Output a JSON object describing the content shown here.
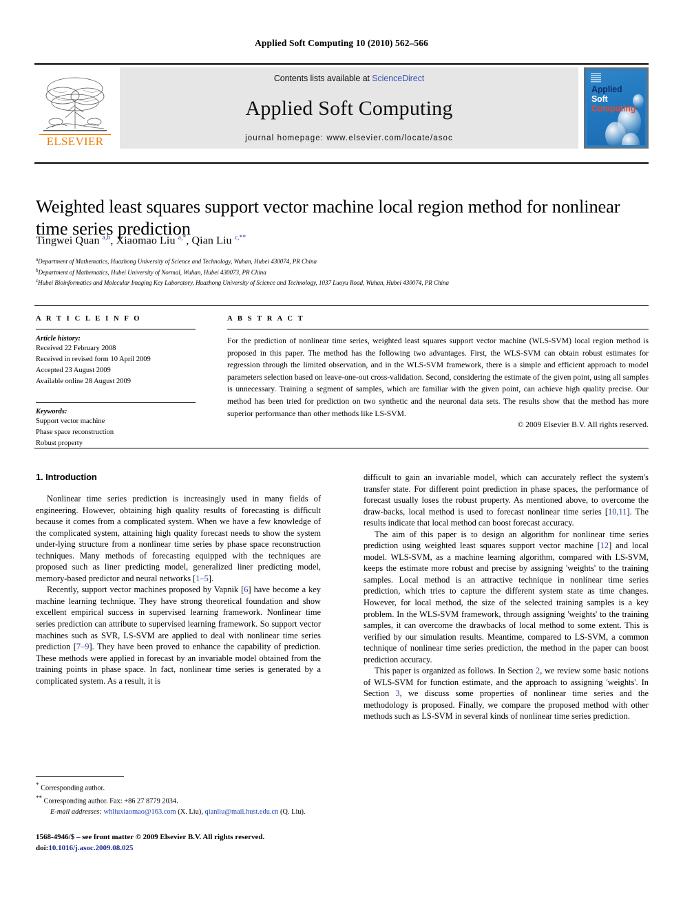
{
  "running_head": "Applied Soft Computing 10 (2010) 562–566",
  "header": {
    "contents_prefix": "Contents lists available at ",
    "sciencedirect": "ScienceDirect",
    "journal_title": "Applied Soft Computing",
    "homepage": "journal homepage: www.elsevier.com/locate/asoc",
    "publisher": "ELSEVIER",
    "cover": {
      "word1": "Applied",
      "word2": "Soft",
      "word3": "Computing",
      "bg_color": "#2076bd",
      "word1_color": "#10306e",
      "word2_color": "#ffffff",
      "word3_color": "#e8492c"
    },
    "link_color": "#3a52b5",
    "elsevier_color": "#f07c00"
  },
  "article": {
    "title": "Weighted least squares support vector machine local region method for nonlinear time series prediction",
    "authors_html": "Tingwei Quan <sup>a,b</sup>, Xiaomao Liu <sup>a,*</sup>, Qian Liu <sup>c,**</sup>",
    "affiliations": [
      {
        "mark": "a",
        "text": "Department of Mathematics, Huazhong University of Science and Technology, Wuhan, Hubei 430074, PR China"
      },
      {
        "mark": "b",
        "text": "Department of Mathematics, Hubei University of Normal, Wuhan, Hubei 430073, PR China"
      },
      {
        "mark": "c",
        "text": "Hubei Bioinformatics and Molecular Imaging Key Laboratory, Huazhong University of Science and Technology, 1037 Luoyu Road, Wuhan, Hubei 430074, PR China"
      }
    ]
  },
  "article_info": {
    "heading": "A R T I C L E  I N F O",
    "history_label": "Article history:",
    "history": [
      "Received 22 February 2008",
      "Received in revised form 10 April 2009",
      "Accepted 23 August 2009",
      "Available online 28 August 2009"
    ],
    "keywords_label": "Keywords:",
    "keywords": [
      "Support vector machine",
      "Phase space reconstruction",
      "Robust property"
    ]
  },
  "abstract": {
    "heading": "A B S T R A C T",
    "text": "For the prediction of nonlinear time series, weighted least squares support vector machine (WLS-SVM) local region method is proposed in this paper. The method has the following two advantages. First, the WLS-SVM can obtain robust estimates for regression through the limited observation, and in the WLS-SVM framework, there is a simple and efficient approach to model parameters selection based on leave-one-out cross-validation. Second, considering the estimate of the given point, using all samples is unnecessary. Training a segment of samples, which are familiar with the given point, can achieve high quality precise. Our method has been tried for prediction on two synthetic and the neuronal data sets. The results show that the method has more superior performance than other methods like LS-SVM.",
    "copyright": "© 2009 Elsevier B.V. All rights reserved."
  },
  "body": {
    "section1_title": "1.  Introduction",
    "left_paragraphs": [
      "Nonlinear time series prediction is increasingly used in many fields of engineering. However, obtaining high quality results of forecasting is difficult because it comes from a complicated system. When we have a few knowledge of the complicated system, attaining high quality forecast needs to show the system under-lying structure from a nonlinear time series by phase space reconstruction techniques. Many methods of forecasting equipped with the techniques are proposed such as liner predicting model, generalized liner predicting model, memory-based predictor and neural networks [1–5].",
      "Recently, support vector machines proposed by Vapnik [6] have become a key machine learning technique. They have strong theoretical foundation and show excellent empirical success in supervised learning framework. Nonlinear time series prediction can attribute to supervised learning framework. So support vector machines such as SVR, LS-SVM are applied to deal with nonlinear time series prediction [7–9]. They have been proved to enhance the capability of prediction. These methods were applied in forecast by an invariable model obtained from the training points in phase space. In fact, nonlinear time series is generated by a complicated system. As a result, it is"
    ],
    "right_paragraphs": [
      "difficult to gain an invariable model, which can accurately reflect the system's transfer state. For different point prediction in phase spaces, the performance of forecast usually loses the robust property. As mentioned above, to overcome the draw-backs, local method is used to forecast nonlinear time series [10,11]. The results indicate that local method can boost forecast accuracy.",
      "The aim of this paper is to design an algorithm for nonlinear time series prediction using weighted least squares support vector machine [12] and local model. WLS-SVM, as a machine learning algorithm, compared with LS-SVM, keeps the estimate more robust and precise by assigning 'weights' to the training samples. Local method is an attractive technique in nonlinear time series prediction, which tries to capture the different system state as time changes. However, for local method, the size of the selected training samples is a key problem. In the WLS-SVM framework, through assigning 'weights' to the training samples, it can overcome the drawbacks of local method to some extent. This is verified by our simulation results. Meantime, compared to LS-SVM, a common technique of nonlinear time series prediction, the method in the paper can boost prediction accuracy.",
      "This paper is organized as follows. In Section 2, we review some basic notions of WLS-SVM for function estimate, and the approach to assigning 'weights'. In Section 3, we discuss some properties of nonlinear time series and the methodology is proposed. Finally, we compare the proposed method with other methods such as LS-SVM in several kinds of nonlinear time series prediction."
    ]
  },
  "footnotes": {
    "line1": "Corresponding author.",
    "line1_mark": "*",
    "line2": "Corresponding author. Fax: +86 27 8779 2034.",
    "line2_mark": "**",
    "email_label": "E-mail addresses:",
    "email1": "whliuxiaomao@163.com",
    "email1_person": "(X. Liu)",
    "email2": "qianliu@mail.hust.edu.cn",
    "email2_person": "(Q. Liu)."
  },
  "imprint": {
    "line1": "1568-4946/$ – see front matter © 2009 Elsevier B.V. All rights reserved.",
    "doi_label": "doi:",
    "doi_value": "10.1016/j.asoc.2009.08.025"
  }
}
